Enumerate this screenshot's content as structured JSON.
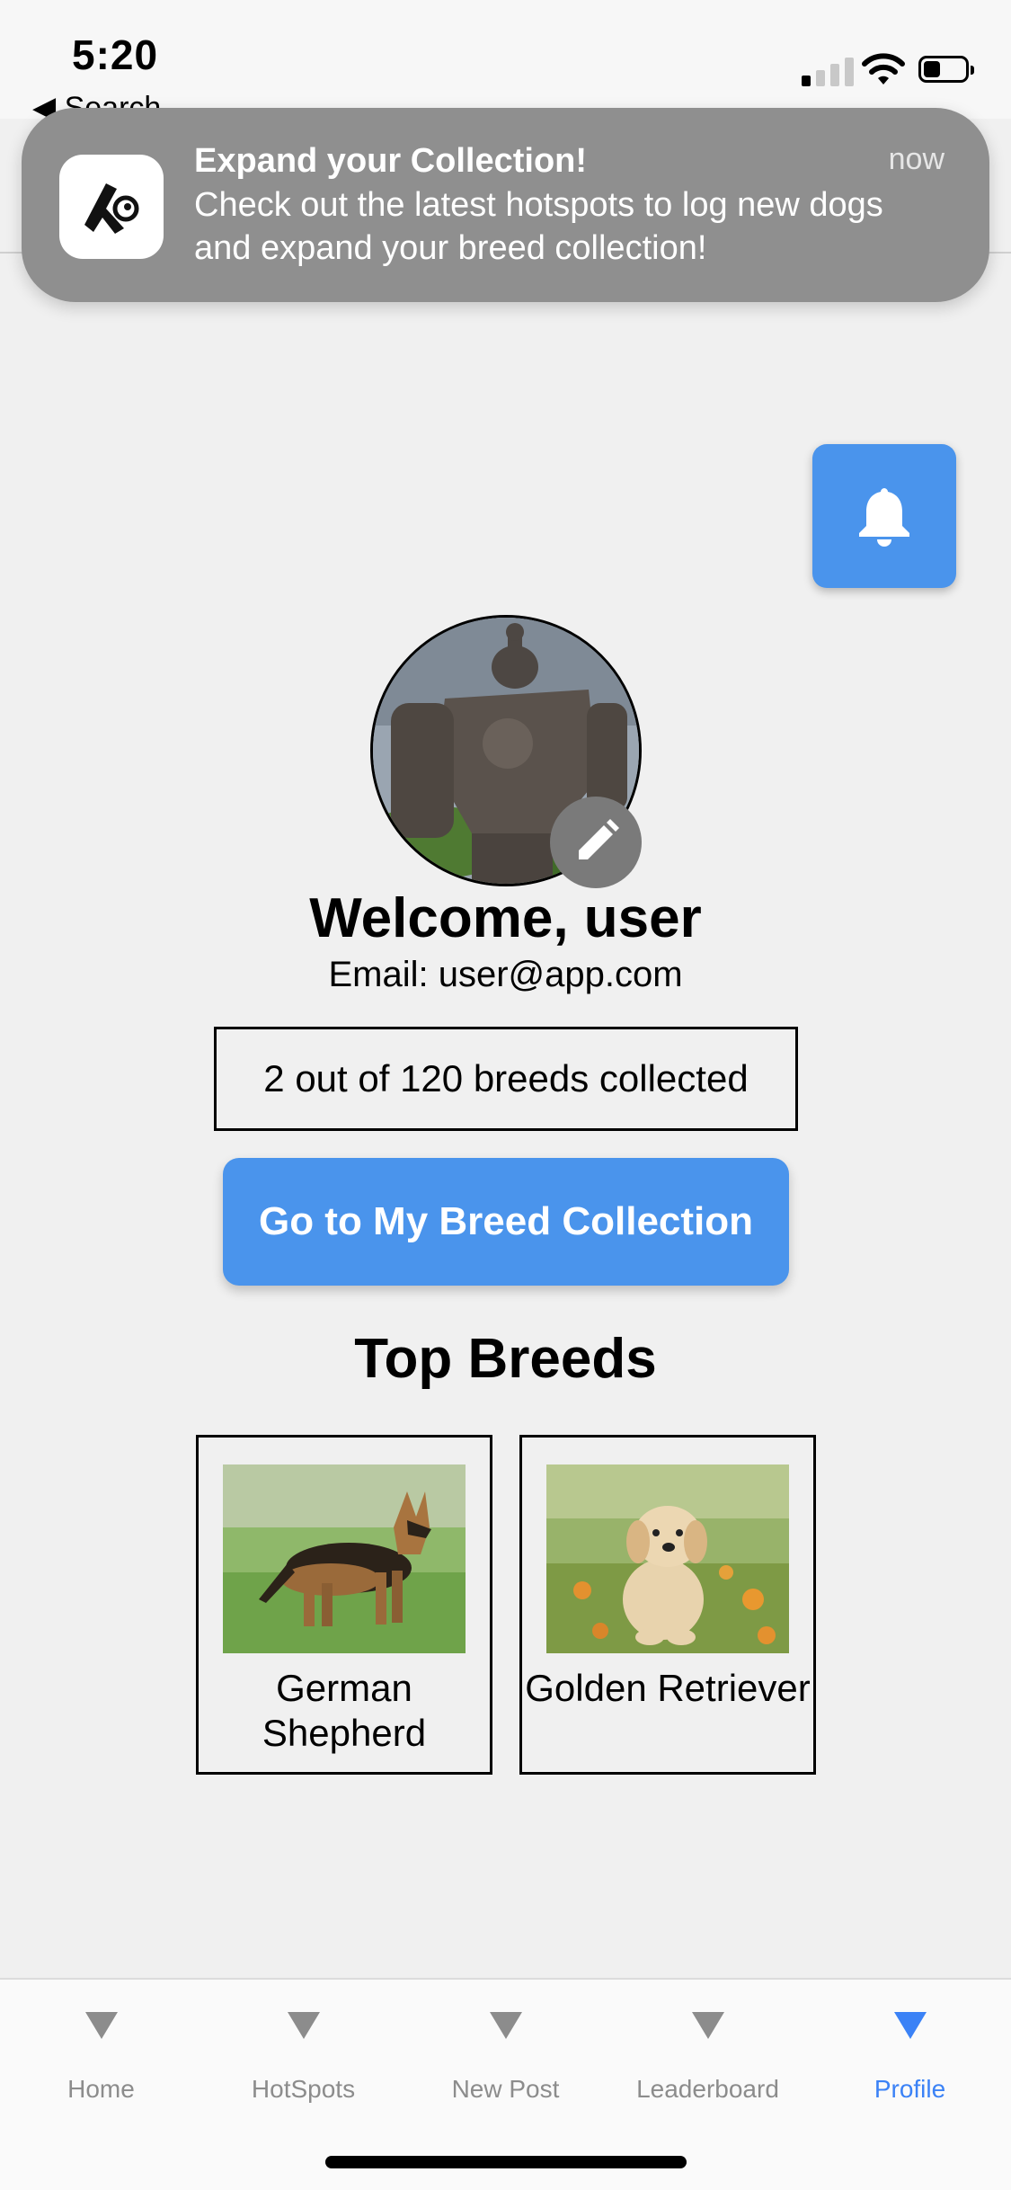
{
  "status_bar": {
    "time": "5:20",
    "back_label": "◀ Search"
  },
  "notification": {
    "title": "Expand your Collection!",
    "body": "Check out the latest hotspots to log new dogs and expand your breed collection!",
    "time": "now"
  },
  "profile": {
    "welcome": "Welcome, user",
    "email": "Email: user@app.com",
    "breed_count": "2 out of 120 breeds collected",
    "collection_button": "Go to My Breed Collection"
  },
  "top_breeds": {
    "title": "Top Breeds",
    "items": [
      {
        "name": "German Shepherd"
      },
      {
        "name": "Golden Retriever"
      }
    ]
  },
  "tab_bar": {
    "tabs": [
      {
        "label": "Home"
      },
      {
        "label": "HotSpots"
      },
      {
        "label": "New Post"
      },
      {
        "label": "Leaderboard"
      },
      {
        "label": "Profile"
      }
    ],
    "active_tab": "Profile"
  },
  "colors": {
    "accent": "#4a94ec",
    "active_tab": "#3b82f6",
    "inactive_tab": "#8c8c8c",
    "banner": "#8f8f8f"
  },
  "icons": [
    "app-logo-icon",
    "bell-icon",
    "edit-pencil-icon",
    "tab-triangle-icon",
    "signal-icon",
    "wifi-icon",
    "battery-icon"
  ]
}
